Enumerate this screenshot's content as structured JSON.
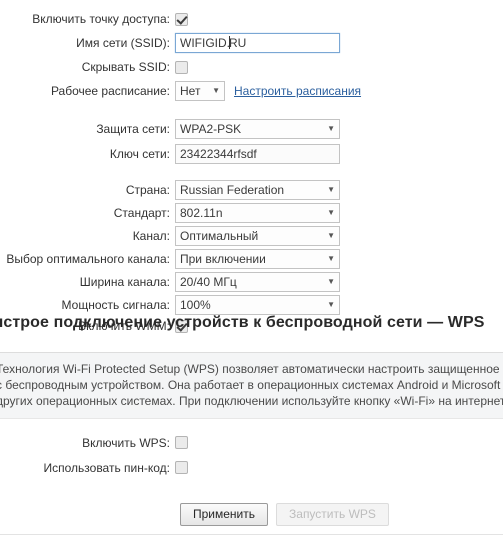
{
  "wifi_section": {
    "rows": [
      {
        "id": "enable-ap",
        "label": "Включить точку доступа:",
        "type": "checkbox",
        "checked": true
      },
      {
        "id": "ssid",
        "label": "Имя сети (SSID):",
        "type": "text",
        "value": "WIFIGID.RU",
        "focused": true
      },
      {
        "id": "hide-ssid",
        "label": "Скрывать SSID:",
        "type": "checkbox",
        "checked": false
      },
      {
        "id": "schedule",
        "label": "Рабочее расписание:",
        "type": "select",
        "value": "Нет",
        "link": "Настроить расписания"
      },
      {
        "id": "security",
        "label": "Защита сети:",
        "type": "select",
        "value": "WPA2-PSK"
      },
      {
        "id": "network-key",
        "label": "Ключ сети:",
        "type": "text",
        "value": "23422344rfsdf",
        "focused": false
      },
      {
        "id": "country",
        "label": "Страна:",
        "type": "select",
        "value": "Russian Federation"
      },
      {
        "id": "standard",
        "label": "Стандарт:",
        "type": "select",
        "value": "802.11n"
      },
      {
        "id": "channel",
        "label": "Канал:",
        "type": "select",
        "value": "Оптимальный"
      },
      {
        "id": "auto-channel",
        "label": "Выбор оптимального канала:",
        "type": "select",
        "value": "При включении"
      },
      {
        "id": "channel-width",
        "label": "Ширина канала:",
        "type": "select",
        "value": "20/40 МГц"
      },
      {
        "id": "signal-power",
        "label": "Мощность сигнала:",
        "type": "select",
        "value": "100%"
      },
      {
        "id": "enable-wmm",
        "label": "Включить WMM:",
        "type": "checkbox",
        "checked": true
      }
    ]
  },
  "wps_section": {
    "heading": "Быстрое подключение устройств к беспроводной сети — WPS",
    "info_lines": [
      "Технология Wi-Fi Protected Setup (WPS) позволяет автоматически настроить защищенное соединение",
      "с беспроводным устройством. Она работает в операционных системах Android и Microsoft Windows, а также во многих",
      "других операционных системах. При подключении используйте кнопку «Wi-Fi» на интернет-центре."
    ],
    "rows": [
      {
        "id": "enable-wps",
        "label": "Включить WPS:",
        "type": "checkbox",
        "checked": false
      },
      {
        "id": "use-pin",
        "label": "Использовать пин-код:",
        "type": "checkbox",
        "checked": false
      }
    ]
  },
  "buttons": {
    "apply": "Применить",
    "start_wps": "Запустить WPS"
  },
  "colors": {
    "link": "#2b5f9e",
    "info_bg": "#f4f5f6",
    "focus_border": "#7aa7d4"
  },
  "icons": {
    "dropdown_arrow": "▼",
    "checkmark": "✔"
  }
}
